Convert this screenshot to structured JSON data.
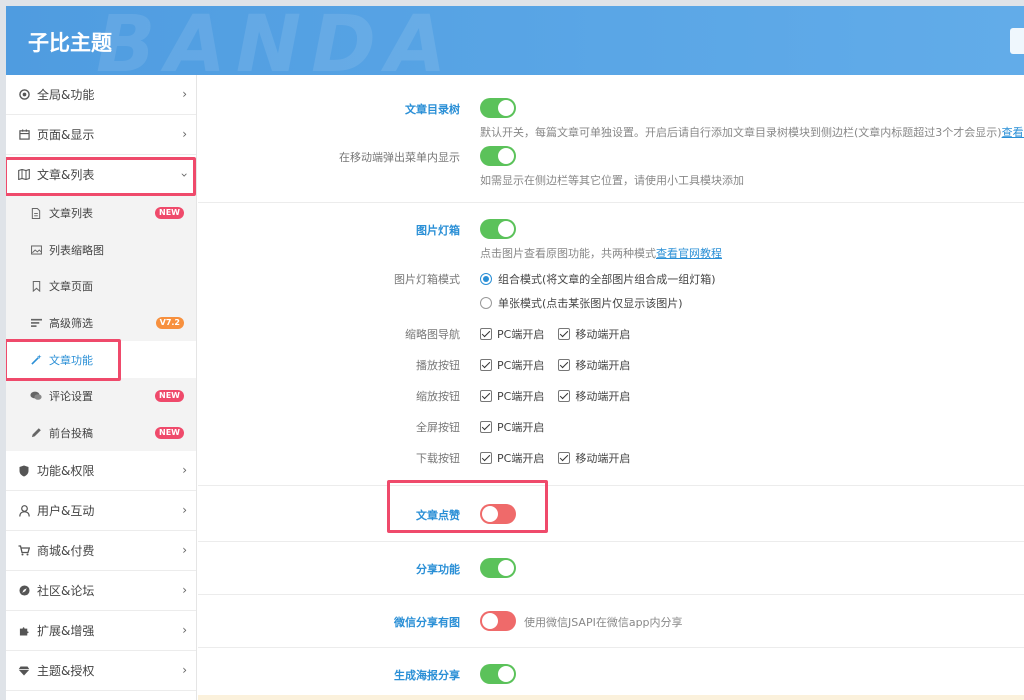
{
  "header": {
    "title": "子比主题",
    "watermark": "BANDA"
  },
  "sidebar": {
    "items": [
      {
        "label": "全局&功能",
        "icon": "gear-circle-icon"
      },
      {
        "label": "页面&显示",
        "icon": "calendar-icon"
      },
      {
        "label": "文章&列表",
        "icon": "map-icon",
        "expanded": true
      },
      {
        "label": "功能&权限",
        "icon": "shield-icon"
      },
      {
        "label": "用户&互动",
        "icon": "user-icon"
      },
      {
        "label": "商城&付费",
        "icon": "cart-icon"
      },
      {
        "label": "社区&论坛",
        "icon": "compass-icon"
      },
      {
        "label": "扩展&增强",
        "icon": "puzzle-icon"
      },
      {
        "label": "主题&授权",
        "icon": "diamond-icon"
      }
    ],
    "subitems": [
      {
        "label": "文章列表",
        "icon": "file-icon",
        "badge": "NEW"
      },
      {
        "label": "列表缩略图",
        "icon": "image-icon",
        "badge": ""
      },
      {
        "label": "文章页面",
        "icon": "bookmark-icon",
        "badge": ""
      },
      {
        "label": "高级筛选",
        "icon": "filter-icon",
        "badge": "V7.2"
      },
      {
        "label": "文章功能",
        "icon": "magic-wand-icon",
        "badge": "",
        "active": true
      },
      {
        "label": "评论设置",
        "icon": "comments-icon",
        "badge": "NEW"
      },
      {
        "label": "前台投稿",
        "icon": "pencil-icon",
        "badge": "NEW"
      }
    ]
  },
  "main": {
    "toc": {
      "label": "文章目录树",
      "enabled": true,
      "desc": "默认开关，每篇文章可单独设置。开启后请自行添加文章目录树模块到侧边栏(文章内标题超过3个才会显示)",
      "desc_link": "查看官",
      "mobile_label": "在移动端弹出菜单内显示",
      "mobile_enabled": true,
      "mobile_desc": "如需显示在侧边栏等其它位置，请使用小工具模块添加"
    },
    "lightbox": {
      "label": "图片灯箱",
      "enabled": true,
      "desc": "点击图片查看原图功能，共两种模式",
      "desc_link": "查看官网教程",
      "mode_label": "图片灯箱模式",
      "mode_options": [
        "组合模式(将文章的全部图片组合成一组灯箱)",
        "单张模式(点击某张图片仅显示该图片)"
      ],
      "mode_selected": 0,
      "pc_label": "PC端开启",
      "mobile_label": "移动端开启",
      "rows": [
        {
          "label": "缩略图导航",
          "pc": true,
          "mobile": true
        },
        {
          "label": "播放按钮",
          "pc": true,
          "mobile": true
        },
        {
          "label": "缩放按钮",
          "pc": true,
          "mobile": true
        },
        {
          "label": "全屏按钮",
          "pc": true
        },
        {
          "label": "下载按钮",
          "pc": true,
          "mobile": true
        }
      ]
    },
    "like": {
      "label": "文章点赞",
      "enabled": false
    },
    "share": {
      "label": "分享功能",
      "enabled": true
    },
    "wechat": {
      "label": "微信分享有图",
      "enabled": false,
      "desc": "使用微信JSAPI在微信app内分享"
    },
    "poster": {
      "label": "生成海报分享",
      "enabled": true
    }
  },
  "colors": {
    "accent": "#2a8fd6",
    "toggle_on": "#5bc25a",
    "toggle_off": "#ef6a6a",
    "highlight": "#ef4a6b",
    "header": "#5aa6e6"
  }
}
